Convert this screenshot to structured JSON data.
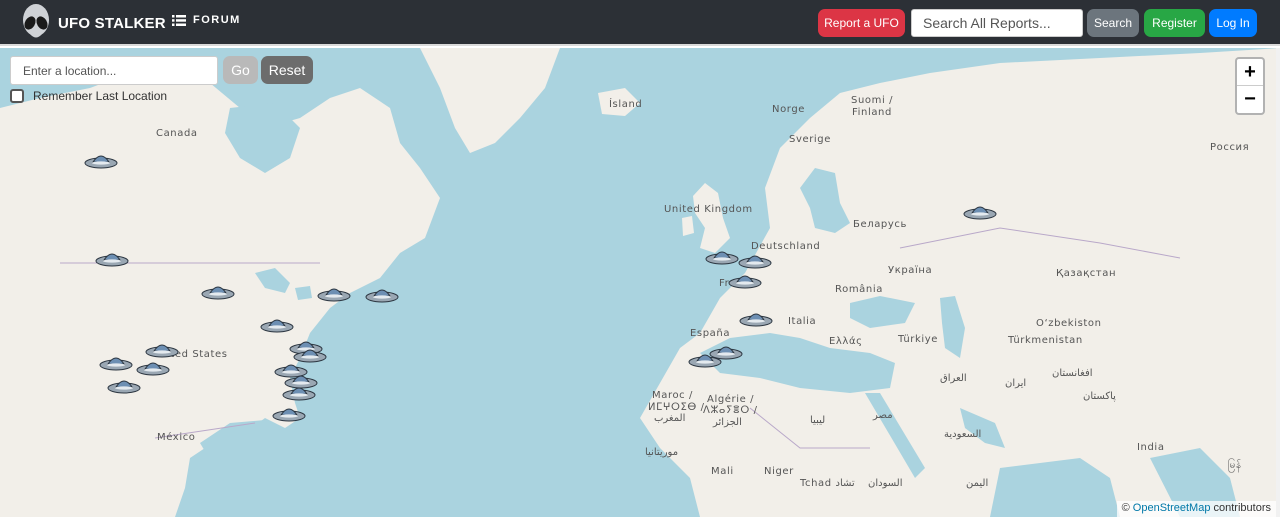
{
  "header": {
    "brand": "UFO STALKER",
    "forum": "FORUM",
    "report_button": "Report a UFO",
    "search_placeholder": "Search All Reports...",
    "search_button": "Search",
    "register_button": "Register",
    "login_button": "Log In",
    "colors": {
      "navbar": "#2c3036",
      "report": "#dc3545",
      "search": "#6c757d",
      "register": "#28a745",
      "login": "#007bff"
    }
  },
  "map": {
    "location_placeholder": "Enter a location...",
    "go_button": "Go",
    "reset_button": "Reset",
    "remember_label": "Remember Last Location",
    "remember_checked": false,
    "zoom_in": "+",
    "zoom_out": "−",
    "attribution_prefix": "©",
    "attribution_link": "OpenStreetMap",
    "attribution_suffix": "contributors",
    "labels": {
      "canada": "Canada",
      "island": "Ísland",
      "norge": "Norge",
      "suomi": "Suomi /",
      "finland": "Finland",
      "sverige": "Sverige",
      "rossiya": "Россия",
      "uk": "United Kingdom",
      "belarus": "Беларусь",
      "deutschland": "Deutschland",
      "ukraina": "Україна",
      "kazakhstan": "Қазақстан",
      "france": "Fra",
      "romania": "România",
      "italia": "Italia",
      "espana": "España",
      "ozbekiston": "O‘zbekiston",
      "turkmenistan": "Türkmenistan",
      "turkiye": "Türkiye",
      "ellas": "Ελλάς",
      "united_states": "nited States",
      "iraq": "العراق",
      "iran": "ایران",
      "afghanistan": "افغانستان",
      "pakistan": "پاکستان",
      "maroc1": "Maroc /",
      "maroc2": "ⵍⵎⵖⵔⵉⴱ /",
      "maroc3": "المغرب",
      "algerie1": "Algérie /",
      "algerie2": "ⴷⵣⴰⵢⴻⵔ /",
      "algerie3": "الجزائر",
      "libya": "ليبيا",
      "misr": "مصر",
      "saudi": "السعودية",
      "mexico": "México",
      "mauritania": "موريتانيا",
      "mali": "Mali",
      "niger": "Niger",
      "tchad": "Tchad تشاد",
      "sudan": "السودان",
      "yemen": "اليمن",
      "india": "India",
      "myanmar": "မြန်"
    },
    "sightings": [
      {
        "region": "canada-northwest"
      },
      {
        "region": "usa-pacific-northwest"
      },
      {
        "region": "usa-midwest"
      },
      {
        "region": "usa-great-lakes"
      },
      {
        "region": "usa-northeast"
      },
      {
        "region": "canada-maritimes"
      },
      {
        "region": "usa-east-coast-1"
      },
      {
        "region": "usa-east-coast-2"
      },
      {
        "region": "usa-southwest-1"
      },
      {
        "region": "usa-southwest-2"
      },
      {
        "region": "usa-california-1"
      },
      {
        "region": "usa-california-2"
      },
      {
        "region": "usa-southeast-1"
      },
      {
        "region": "usa-southeast-2"
      },
      {
        "region": "usa-southeast-3"
      },
      {
        "region": "usa-florida"
      },
      {
        "region": "uk"
      },
      {
        "region": "benelux"
      },
      {
        "region": "france"
      },
      {
        "region": "mediterranean"
      },
      {
        "region": "spain-1"
      },
      {
        "region": "spain-2"
      },
      {
        "region": "russia"
      }
    ]
  }
}
